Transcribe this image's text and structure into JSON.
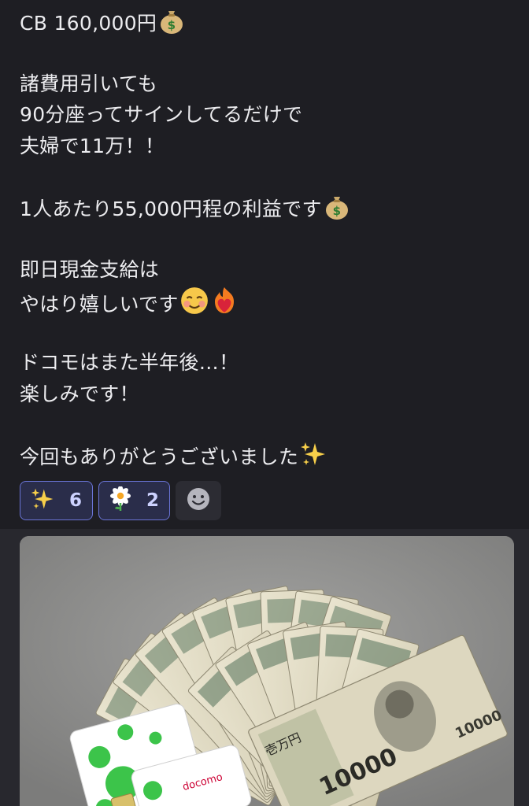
{
  "message": {
    "lines": [
      "CB 160,000円",
      "",
      "諸費用引いても",
      "90分座ってサインしてるだけで",
      "夫婦で11万！！",
      "",
      "1人あたり55,000円程の利益です",
      "",
      "即日現金支給は",
      "やはり嬉しいです",
      "",
      "ドコモはまた半年後…！",
      "楽しみです！",
      "",
      "今回もありがとうございました"
    ],
    "emojis": {
      "money_bag": "money-bag",
      "blush": "smiling-face-blush",
      "fire_heart": "heart-on-fire",
      "sparkles": "sparkles"
    }
  },
  "reactions": [
    {
      "emoji": "sparkles",
      "count": "6"
    },
    {
      "emoji": "white-flower",
      "count": "2"
    }
  ],
  "photo": {
    "subject": "fanned 10000 yen banknotes and docomo SIM cards",
    "banknote_label": "10000",
    "banknote_kanji": "壱万円",
    "sim_brand": "docomo"
  },
  "colors": {
    "background": "#1e1e23",
    "reaction_active_bg": "#2a2d4a",
    "reaction_active_border": "#6a74d6",
    "reaction_count": "#cdd2ff"
  }
}
